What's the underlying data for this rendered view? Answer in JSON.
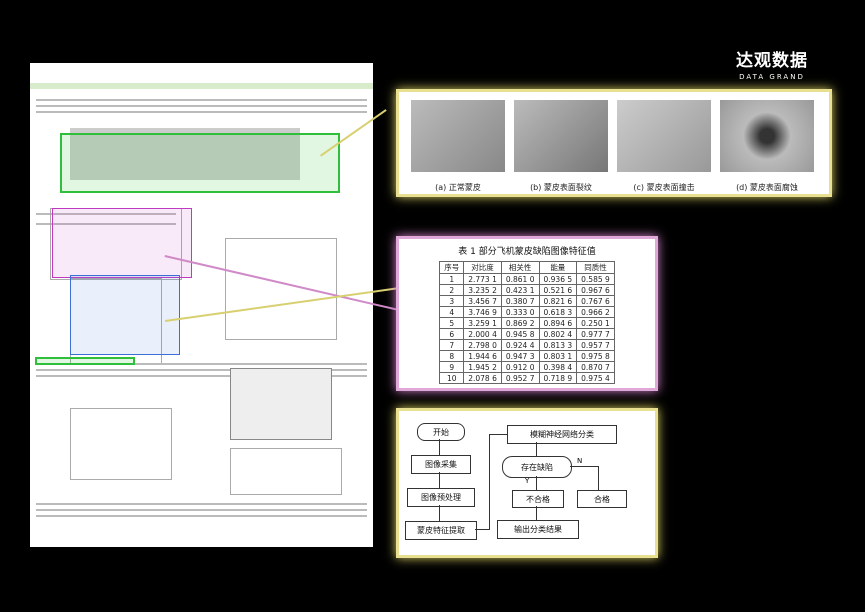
{
  "logo": {
    "cn": "达观数据",
    "en": "DATA GRAND"
  },
  "figure": {
    "captions": [
      "(a) 正常蒙皮",
      "(b) 蒙皮表面裂纹",
      "(c) 蒙皮表面撞击",
      "(d) 蒙皮表面腐蚀"
    ]
  },
  "table": {
    "title": "表 1  部分飞机蒙皮缺陷图像特征值",
    "headers": [
      "序号",
      "对比度",
      "相关性",
      "能量",
      "同质性"
    ],
    "rows": [
      [
        "1",
        "2.773 1",
        "0.861 0",
        "0.936 5",
        "0.585 9"
      ],
      [
        "2",
        "3.235 2",
        "0.423 1",
        "0.521 6",
        "0.967 6"
      ],
      [
        "3",
        "3.456 7",
        "0.380 7",
        "0.821 6",
        "0.767 6"
      ],
      [
        "4",
        "3.746 9",
        "0.333 0",
        "0.618 3",
        "0.966 2"
      ],
      [
        "5",
        "3.259 1",
        "0.869 2",
        "0.894 6",
        "0.250 1"
      ],
      [
        "6",
        "2.000 4",
        "0.945 8",
        "0.802 4",
        "0.977 7"
      ],
      [
        "7",
        "2.798 0",
        "0.924 4",
        "0.813 3",
        "0.957 7"
      ],
      [
        "8",
        "1.944 6",
        "0.947 3",
        "0.803 1",
        "0.975 8"
      ],
      [
        "9",
        "1.945 2",
        "0.912 0",
        "0.398 4",
        "0.870 7"
      ],
      [
        "10",
        "2.078 6",
        "0.952 7",
        "0.718 9",
        "0.975 4"
      ]
    ]
  },
  "flow": {
    "start": "开始",
    "acquire": "图像采集",
    "preprocess": "图像预处理",
    "feature": "蒙皮特征提取",
    "classify": "模糊神经网络分类",
    "defect": "存在缺陷",
    "y": "Y",
    "n": "N",
    "fail": "不合格",
    "pass": "合格",
    "output": "输出分类结果"
  }
}
